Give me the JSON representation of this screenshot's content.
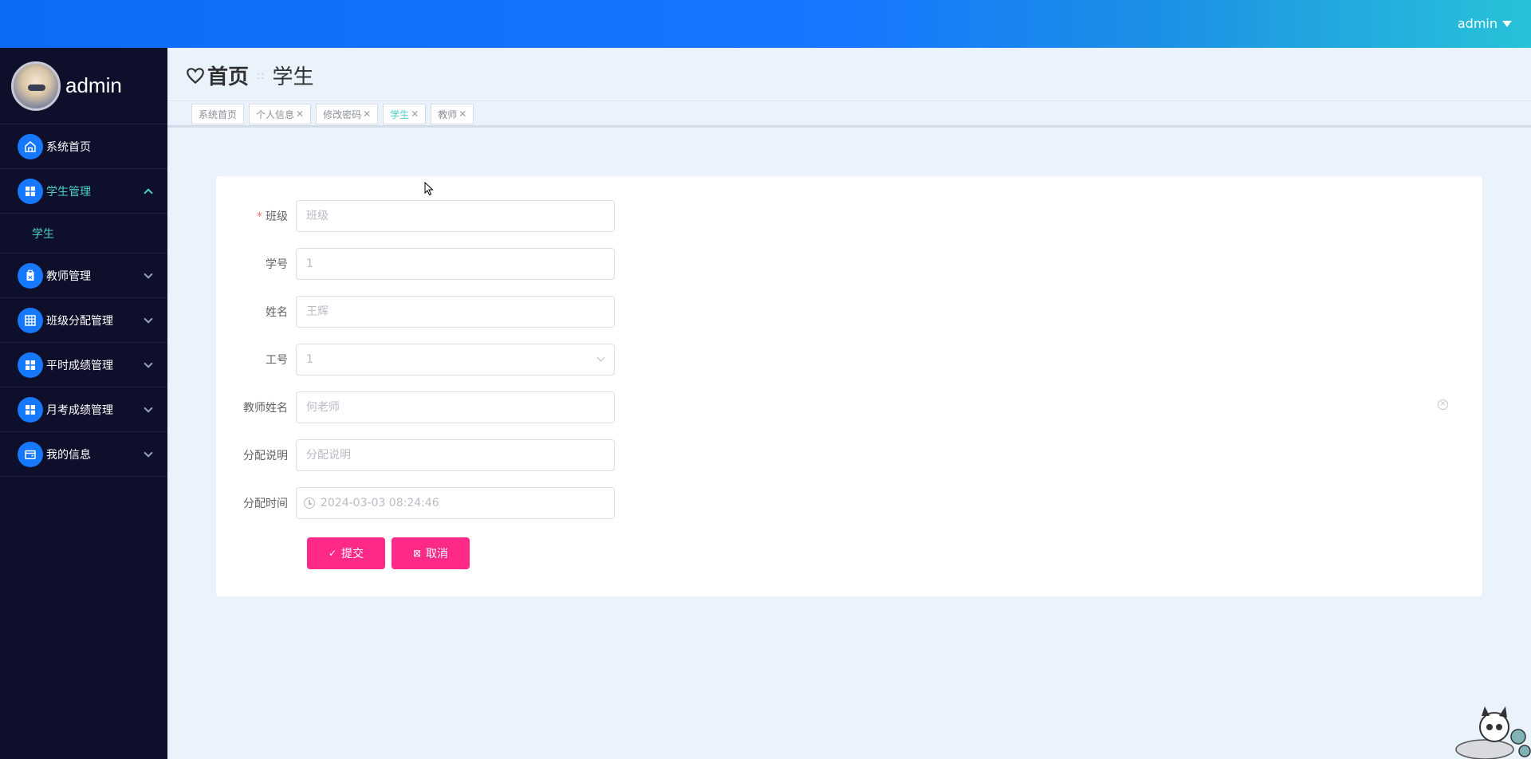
{
  "topbar": {
    "user_label": "admin"
  },
  "sidebar": {
    "profile_name": "admin",
    "items": [
      {
        "label": "系统首页",
        "icon": "home-icon"
      },
      {
        "label": "学生管理",
        "icon": "grid-icon",
        "expanded": true,
        "children": [
          {
            "label": "学生"
          }
        ]
      },
      {
        "label": "教师管理",
        "icon": "clipboard-icon"
      },
      {
        "label": "班级分配管理",
        "icon": "table-icon"
      },
      {
        "label": "平时成绩管理",
        "icon": "grid-icon"
      },
      {
        "label": "月考成绩管理",
        "icon": "grid-icon"
      },
      {
        "label": "我的信息",
        "icon": "wallet-icon"
      }
    ]
  },
  "header": {
    "home": "首页",
    "separator": "::",
    "current": "学生"
  },
  "tabs": [
    {
      "label": "系统首页",
      "closable": false
    },
    {
      "label": "个人信息",
      "closable": true
    },
    {
      "label": "修改密码",
      "closable": true
    },
    {
      "label": "学生",
      "closable": true,
      "active": true
    },
    {
      "label": "教师",
      "closable": true
    }
  ],
  "form": {
    "class": {
      "label": "班级",
      "required": true,
      "placeholder": "班级",
      "value": ""
    },
    "student_no": {
      "label": "学号",
      "value": "1"
    },
    "name": {
      "label": "姓名",
      "value": "王辉"
    },
    "work_no": {
      "label": "工号",
      "value": "1"
    },
    "teacher_name": {
      "label": "教师姓名",
      "value": "何老师"
    },
    "description": {
      "label": "分配说明",
      "placeholder": "分配说明",
      "value": ""
    },
    "time": {
      "label": "分配时间",
      "value": "2024-03-03 08:24:46"
    }
  },
  "buttons": {
    "submit": "提交",
    "cancel": "取消"
  },
  "colors": {
    "accent": "#1677ff",
    "active_text": "#4fd1c5",
    "button": "#ff2a88",
    "sidebar_bg": "#0e0f2a"
  }
}
